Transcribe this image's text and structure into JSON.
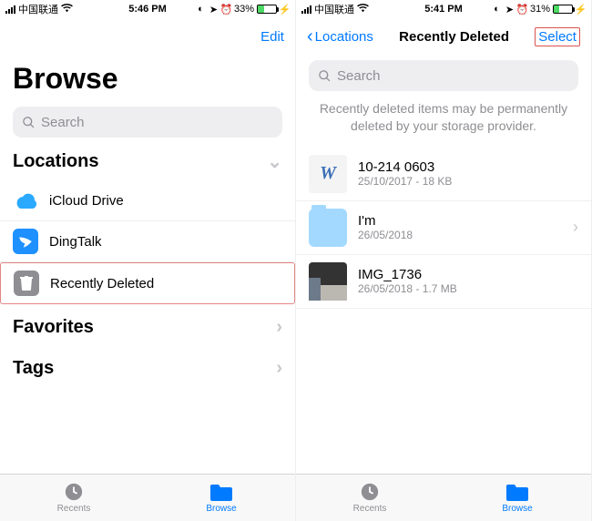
{
  "left": {
    "status": {
      "carrier": "中国联通",
      "time": "5:46 PM",
      "battery_pct": "33%",
      "battery_fill": "33%"
    },
    "nav": {
      "edit": "Edit"
    },
    "title": "Browse",
    "search_placeholder": "Search",
    "locations_label": "Locations",
    "locations": [
      {
        "name": "iCloud Drive"
      },
      {
        "name": "DingTalk"
      },
      {
        "name": "Recently Deleted"
      }
    ],
    "favorites_label": "Favorites",
    "tags_label": "Tags",
    "tabs": {
      "recents": "Recents",
      "browse": "Browse"
    }
  },
  "right": {
    "status": {
      "carrier": "中国联通",
      "time": "5:41 PM",
      "battery_pct": "31%",
      "battery_fill": "31%"
    },
    "nav": {
      "back": "Locations",
      "title": "Recently Deleted",
      "select": "Select"
    },
    "search_placeholder": "Search",
    "notice": "Recently deleted items may be permanently deleted by your storage provider.",
    "files": [
      {
        "name": "10-214  0603",
        "sub": "25/10/2017 - 18 KB",
        "thumb": "W"
      },
      {
        "name": "I'm",
        "sub": "26/05/2018",
        "thumb": "folder"
      },
      {
        "name": "IMG_1736",
        "sub": "26/05/2018 - 1.7 MB",
        "thumb": "image"
      }
    ],
    "tabs": {
      "recents": "Recents",
      "browse": "Browse"
    }
  }
}
